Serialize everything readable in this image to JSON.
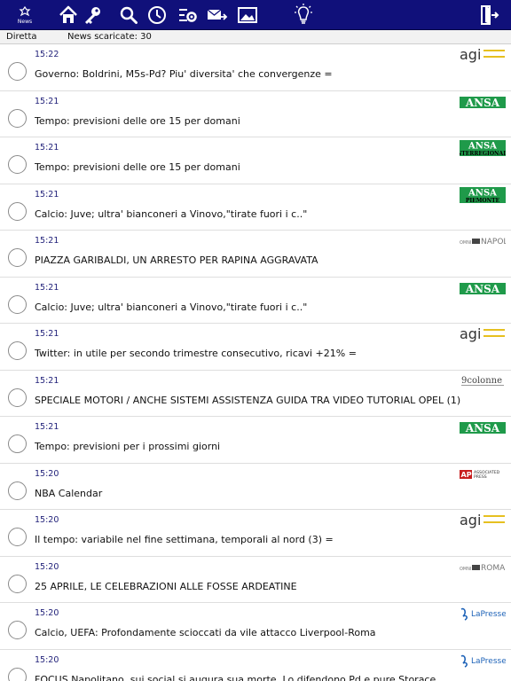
{
  "toolbar": {
    "news_label": "News",
    "icons": [
      "news-icon",
      "home-icon",
      "key-icon",
      "search-icon",
      "clock-icon",
      "settings-icon",
      "send-mail-icon",
      "image-icon",
      "bulb-icon",
      "logout-icon"
    ]
  },
  "status": {
    "mode": "Diretta",
    "count": "News scaricate: 30"
  },
  "colors": {
    "toolbar_bg": "#10107a",
    "time_text": "#22227a",
    "ansa_green": "#1f9a4a"
  },
  "items": [
    {
      "time": "15:22",
      "title": "Governo: Boldrini, M5s-Pd? Piu' diversita' che convergenze  =",
      "source": "agi"
    },
    {
      "time": "15:21",
      "title": "Tempo: previsioni delle ore 15 per domani",
      "source": "ANSA"
    },
    {
      "time": "15:21",
      "title": "Tempo: previsioni delle ore 15 per domani",
      "source": "ANSA",
      "sublabel": "INTERREGIONALE"
    },
    {
      "time": "15:21",
      "title": "Calcio: Juve; ultra' bianconeri a Vinovo,\"tirate fuori i c..\"",
      "source": "ANSA",
      "sublabel": "PIEMONTE"
    },
    {
      "time": "15:21",
      "title": "PIAZZA GARIBALDI, UN ARRESTO PER RAPINA AGGRAVATA",
      "source": "NAPOLI",
      "prefix": "OMNI"
    },
    {
      "time": "15:21",
      "title": "Calcio: Juve; ultra' bianconeri a Vinovo,\"tirate fuori i c..\"",
      "source": "ANSA"
    },
    {
      "time": "15:21",
      "title": "Twitter: in utile per secondo trimestre consecutivo, ricavi +21%  =",
      "source": "agi"
    },
    {
      "time": "15:21",
      "title": "SPECIALE MOTORI / ANCHE SISTEMI ASSISTENZA GUIDA TRA VIDEO TUTORIAL OPEL (1)",
      "source": "9colonne"
    },
    {
      "time": "15:21",
      "title": "Tempo: previsioni per i prossimi giorni",
      "source": "ANSA"
    },
    {
      "time": "15:20",
      "title": "NBA Calendar",
      "source": "ASSOCIATED PRESS",
      "prefix": "AP"
    },
    {
      "time": "15:20",
      "title": "Il tempo: variabile nel fine settimana, temporali al nord (3) =",
      "source": "agi"
    },
    {
      "time": "15:20",
      "title": "25 APRILE, LE CELEBRAZIONI ALLE FOSSE ARDEATINE",
      "source": "ROMA",
      "prefix": "OMNI"
    },
    {
      "time": "15:20",
      "title": "Calcio, UEFA: Profondamente scioccati da vile attacco Liverpool-Roma",
      "source": "LaPresse"
    },
    {
      "time": "15:20",
      "title": "FOCUS Napolitano, sui social si augura sua morte. Lo difendono Pd e pure Storace",
      "source": "LaPresse"
    }
  ]
}
